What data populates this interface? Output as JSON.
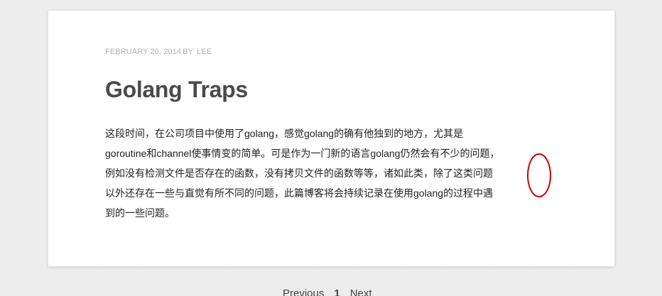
{
  "post": {
    "meta_date": "FEBRUARY 20, 2014",
    "meta_by": "BY",
    "meta_author": "LEE",
    "title": "Golang Traps",
    "body_lines": [
      "这段时间，在公司项目中使用了golang，感觉golang的确有他独到的地方，尤其是",
      "goroutine和channel使事情变的简单。可是作为一门新的语言golang仍然会有不少的问题，",
      "例如没有检测文件是否存在的函数，没有拷贝文件的函数等等，诸如此类，除了这类问题",
      "以外还存在一些与直觉有所不同的问题，此篇博客将会持续记录在使用golang的过程中遇",
      "到的一些问题。"
    ]
  },
  "annotation": {
    "color": "#cc0000"
  },
  "pagination": {
    "previous_label": "Previous",
    "current_page": "1",
    "next_label": "Next"
  }
}
